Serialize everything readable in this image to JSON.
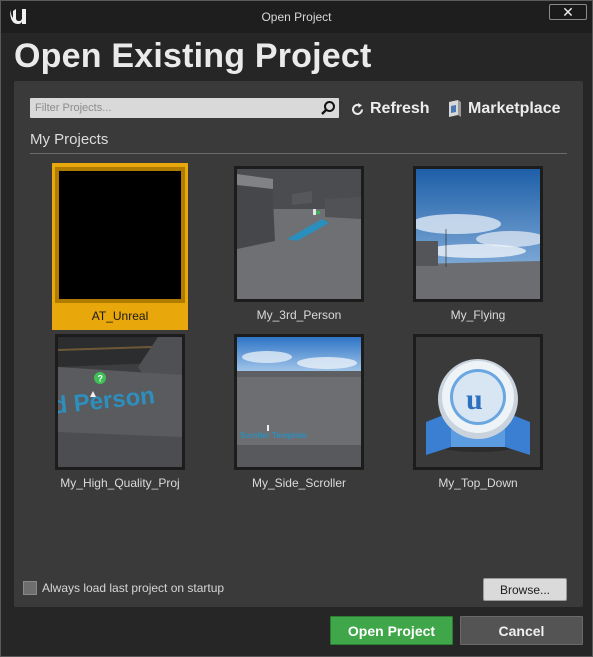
{
  "window": {
    "title": "Open Project",
    "close_glyph": "✕"
  },
  "heading": "Open Existing Project",
  "toolbar": {
    "filter_placeholder": "Filter Projects...",
    "refresh_label": "Refresh",
    "marketplace_label": "Marketplace"
  },
  "section_title": "My Projects",
  "projects": [
    {
      "name": "AT_Unreal",
      "selected": true,
      "thumb": "black"
    },
    {
      "name": "My_3rd_Person",
      "selected": false,
      "thumb": "third-person-level"
    },
    {
      "name": "My_Flying",
      "selected": false,
      "thumb": "sky-level"
    },
    {
      "name": "My_High_Quality_Proj",
      "selected": false,
      "thumb": "high-quality-level"
    },
    {
      "name": "My_Side_Scroller",
      "selected": false,
      "thumb": "side-scroller-level"
    },
    {
      "name": "My_Top_Down",
      "selected": false,
      "thumb": "unreal-project-icon"
    }
  ],
  "options": {
    "always_load_label": "Always load last project on startup",
    "always_load_checked": false
  },
  "buttons": {
    "browse": "Browse...",
    "open": "Open Project",
    "cancel": "Cancel"
  },
  "colors": {
    "selection": "#e8a70a",
    "open_button": "#3fa64a",
    "panel": "#3a3a3a",
    "window": "#262626"
  }
}
